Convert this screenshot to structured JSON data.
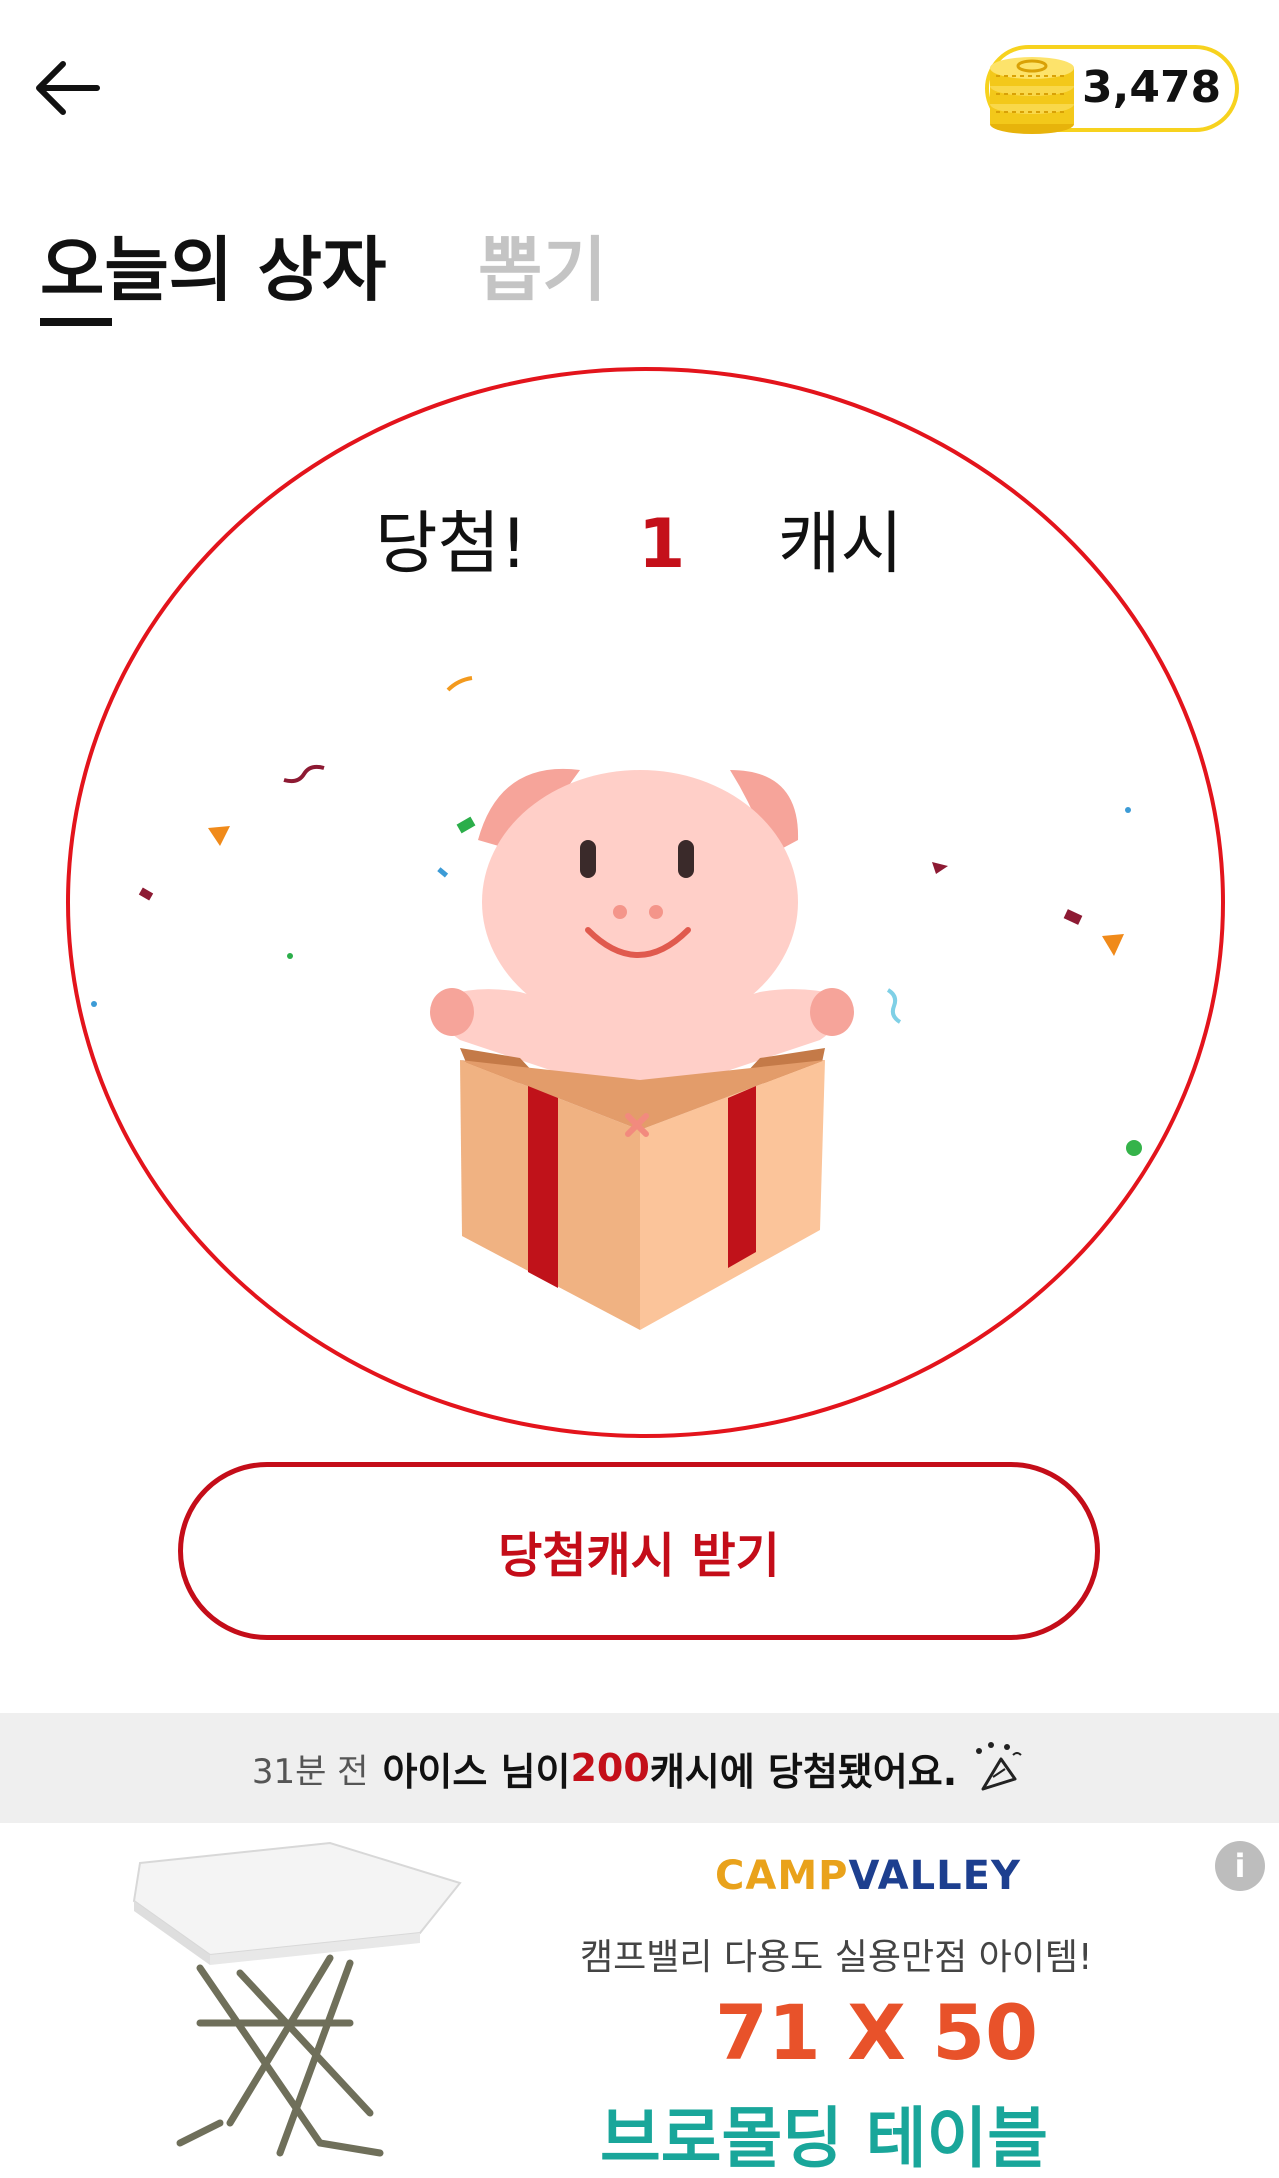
{
  "header": {
    "back_icon": "arrow-left-icon",
    "coin_icon": "coin-stack-icon",
    "coin_balance": "3,478"
  },
  "tabs": [
    {
      "label": "오늘의 상자",
      "active": true
    },
    {
      "label": "뽑기",
      "active": false
    }
  ],
  "result": {
    "label": "당첨!",
    "amount": "1",
    "unit": "캐시"
  },
  "claim_button": {
    "label": "당첨캐시 받기"
  },
  "ticker": {
    "time": "31분 전",
    "prefix": "아이스 님이 ",
    "amount": "200",
    "suffix": "캐시에 당첨됐어요.",
    "icon": "party-popper-icon"
  },
  "ad": {
    "brand_part1": "CAMP",
    "brand_part2": "VALLEY",
    "tagline": "캠프밸리 다용도 실용만점 아이템!",
    "size": "71 X 50",
    "product": "브로몰딩 테이블",
    "info_icon": "info-icon"
  },
  "colors": {
    "accent_red": "#c40d19",
    "circle_red": "#e3141c",
    "coin_yellow": "#f7d21e",
    "pig_pink": "#ffcfc8",
    "box_orange": "#f0b282"
  }
}
